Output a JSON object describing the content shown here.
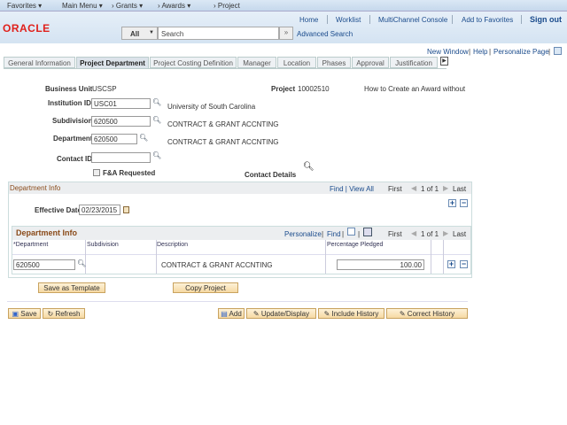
{
  "nav": {
    "favorites": "Favorites ▾",
    "main_menu": "Main Menu ▾",
    "grants": "›  Grants ▾",
    "awards": "›  Awards ▾",
    "project": "›  Project"
  },
  "header": {
    "logo": "ORACLE",
    "home": "Home",
    "worklist": "Worklist",
    "multichannel": "MultiChannel Console",
    "add_favorites": "Add to Favorites",
    "sign_out": "Sign out",
    "search_scope": "All",
    "search_placeholder": "Search",
    "advanced_search": "Advanced Search"
  },
  "pagebar": {
    "new_window": "New Window",
    "help": "Help",
    "personalize": "Personalize Page"
  },
  "tabs": [
    "General Information",
    "Project Department",
    "Project Costing Definition",
    "Manager",
    "Location",
    "Phases",
    "Approval",
    "Justification"
  ],
  "form": {
    "business_unit_label": "Business Unit",
    "business_unit": "USCSP",
    "project_label": "Project",
    "project": "10002510",
    "project_desc": "How to Create an Award without",
    "institution_label": "Institution ID",
    "institution": "USC01",
    "institution_desc": "University of South Carolina",
    "subdivision_label": "Subdivision",
    "subdivision": "620500",
    "subdivision_desc": "CONTRACT & GRANT ACCNTING",
    "department_label": "Department",
    "department": "620500",
    "department_desc": "CONTRACT & GRANT ACCNTING",
    "contact_label": "Contact ID",
    "contact": "",
    "fa_label": "F&A Requested",
    "contact_details": "Contact Details"
  },
  "dept_info": {
    "title": "Department Info",
    "find_viewall": "Find | View All",
    "first": "First",
    "count": "1 of 1",
    "last": "Last",
    "eff_date_label": "Effective Date",
    "eff_date": "02/23/2015"
  },
  "grid": {
    "title": "Department Info",
    "personalize": "Personalize",
    "find": "Find",
    "first": "First",
    "count": "1 of 1",
    "last": "Last",
    "columns": [
      "*Department",
      "Subdivision",
      "Description",
      "Percentage Pledged"
    ],
    "rows": [
      {
        "department": "620500",
        "subdivision": "",
        "description": "CONTRACT & GRANT ACCNTING",
        "pct": "100.00"
      }
    ]
  },
  "buttons": {
    "save_template": "Save as Template",
    "copy_project": "Copy Project",
    "save": "Save",
    "refresh": "Refresh",
    "add": "Add",
    "update": "Update/Display",
    "include_history": "Include History",
    "correct_history": "Correct History"
  }
}
